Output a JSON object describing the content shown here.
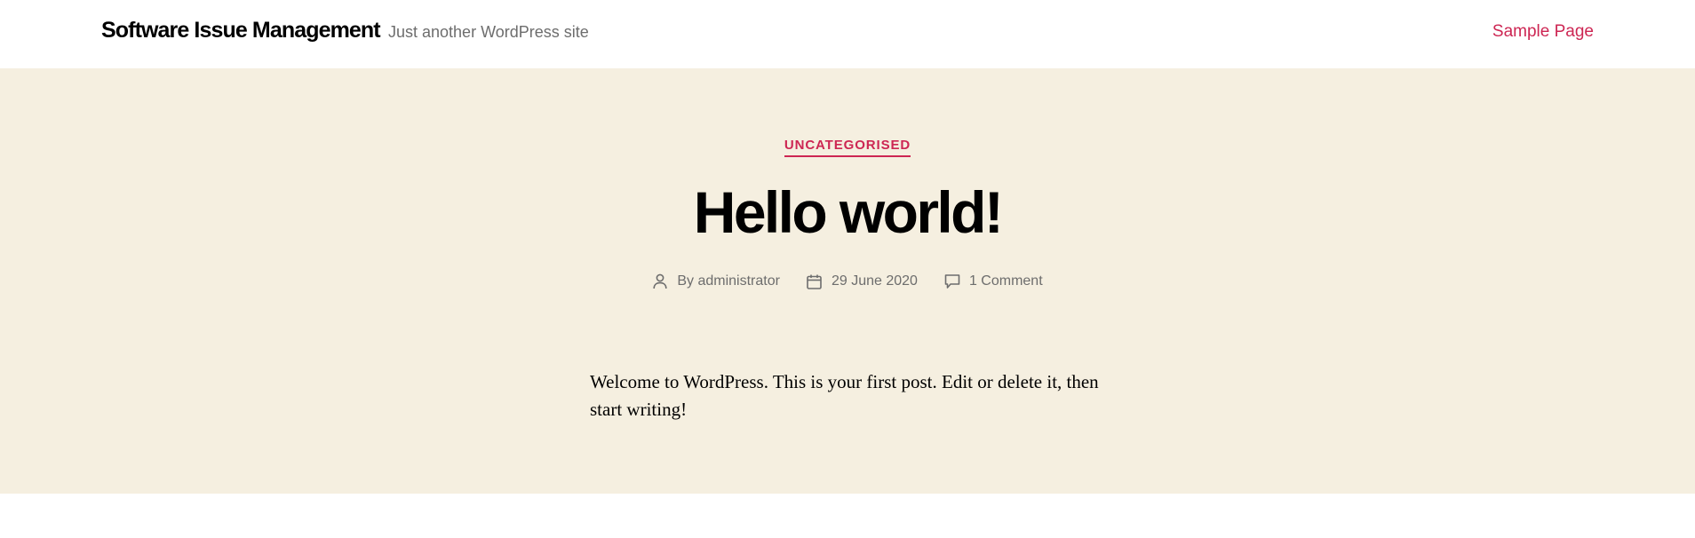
{
  "header": {
    "site_title": "Software Issue Management",
    "site_description": "Just another WordPress site",
    "menu": {
      "sample_page": "Sample Page"
    }
  },
  "post": {
    "category": "UNCATEGORISED",
    "title": "Hello world!",
    "meta": {
      "author_prefix": "By",
      "author": "administrator",
      "date": "29 June 2020",
      "comments": "1 Comment"
    },
    "content": "Welcome to WordPress. This is your first post. Edit or delete it, then start writing!"
  },
  "colors": {
    "accent": "#cd2653",
    "hero_background": "#f5efe0",
    "meta_text": "#6d6d6d"
  },
  "icons": {
    "author": "user-icon",
    "date": "calendar-icon",
    "comments": "comment-icon"
  }
}
